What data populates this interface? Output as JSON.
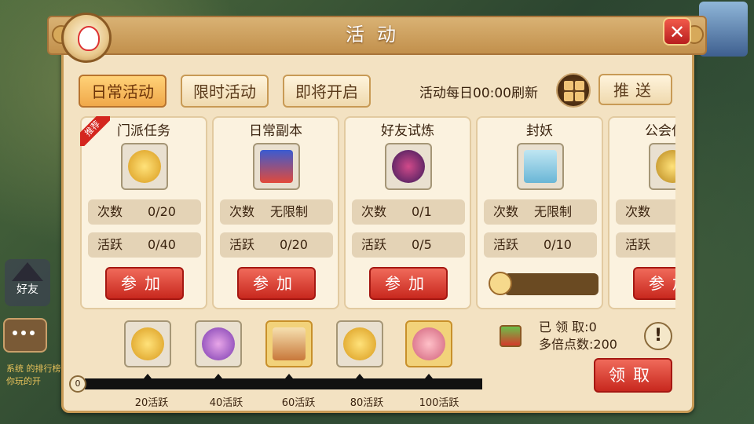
{
  "title": "活动",
  "tabs": [
    {
      "label": "日常活动",
      "active": true
    },
    {
      "label": "限时活动",
      "active": false
    },
    {
      "label": "即将开启",
      "active": false
    }
  ],
  "refresh_text": "活动每日00:00刷新",
  "push_label": "推送",
  "recommend_badge": "推荐",
  "count_key": "次数",
  "active_key": "活跃",
  "join_label": "参加",
  "cards": [
    {
      "title": "门派任务",
      "count": "0/20",
      "activity": "0/40",
      "icon": "gold-medal-icon",
      "has_join": true
    },
    {
      "title": "日常副本",
      "count": "无限制",
      "activity": "0/20",
      "icon": "dungeon-card-icon",
      "has_join": true
    },
    {
      "title": "好友试炼",
      "count": "0/1",
      "activity": "0/5",
      "icon": "purple-orb-icon",
      "has_join": true
    },
    {
      "title": "封妖",
      "count": "无限制",
      "activity": "0/10",
      "icon": "book-icon",
      "has_join": false
    },
    {
      "title": "公会任务",
      "count": "",
      "activity": "",
      "icon": "coin-icon",
      "has_join": true
    }
  ],
  "rewards": {
    "progress_start": "0",
    "tiers": [
      {
        "label": "20活跃",
        "icon": "gold-medal-icon",
        "highlight": false
      },
      {
        "label": "40活跃",
        "icon": "purple-bag-icon",
        "highlight": false
      },
      {
        "label": "60活跃",
        "icon": "scroll-icon",
        "highlight": true
      },
      {
        "label": "80活跃",
        "icon": "gold-medal-icon",
        "highlight": false
      },
      {
        "label": "100活跃",
        "icon": "pink-bag-icon",
        "highlight": true
      }
    ]
  },
  "status": {
    "claimed": "已 领 取:0",
    "multiplier": "多倍点数:200"
  },
  "claim_label": "领取",
  "help_label": "!",
  "close_label": "✕",
  "friend_label": "好友",
  "chat_text": "系统 的排行榜 你玩的开",
  "colors": {
    "panel_bg": "#f3e2c2",
    "accent_red": "#c8281e",
    "tab_active": "#f0a84a"
  }
}
